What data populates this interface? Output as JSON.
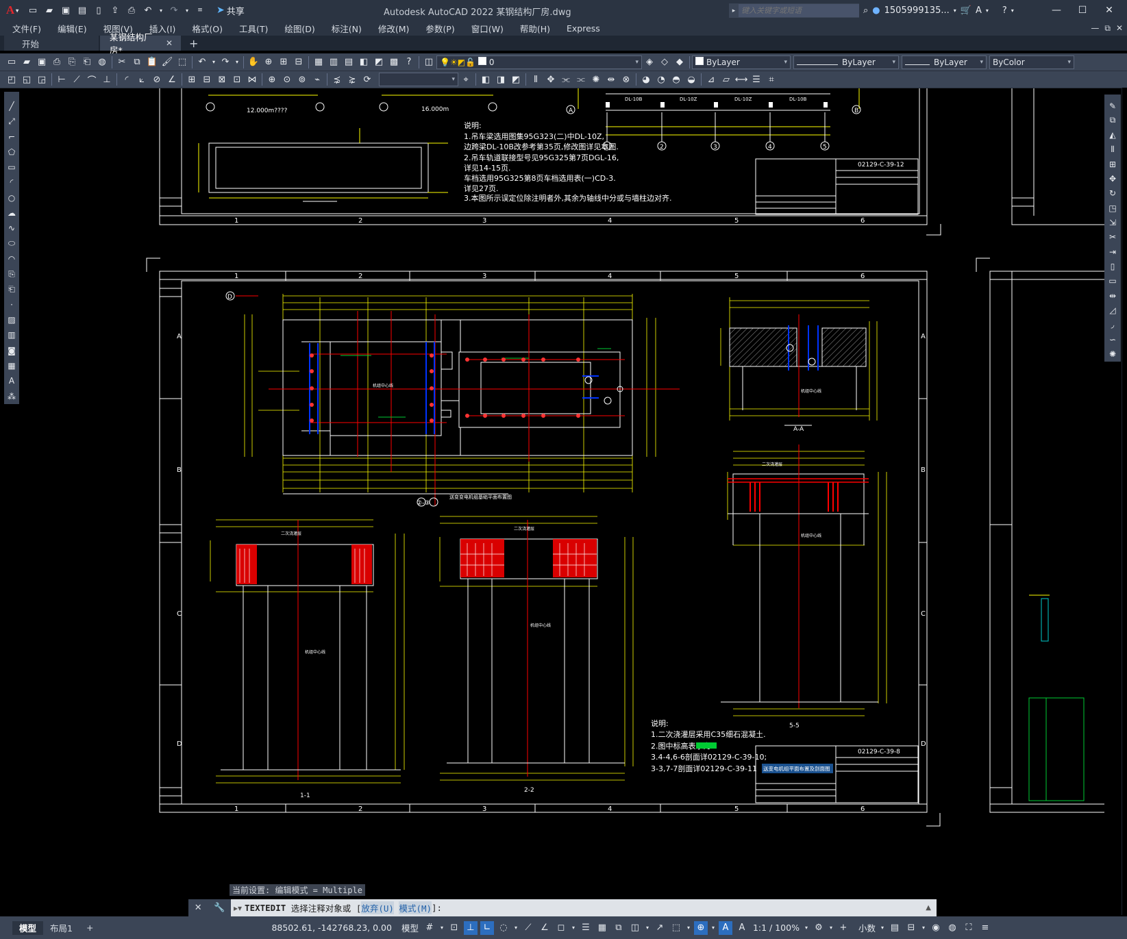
{
  "app": {
    "title": "Autodesk AutoCAD 2022    某钢结构厂房.dwg",
    "logo_letter": "A",
    "share_label": "共享",
    "search_placeholder": "键入关键字或短语",
    "user": "1505999135...",
    "colors": {
      "title_bg": "#2b3442",
      "toolbar_bg": "#3b4556",
      "canvas_bg": "#000000",
      "accent": "#2c6ebf",
      "logo": "#e2262b"
    }
  },
  "menu": {
    "items": [
      "文件(F)",
      "编辑(E)",
      "视图(V)",
      "插入(I)",
      "格式(O)",
      "工具(T)",
      "绘图(D)",
      "标注(N)",
      "修改(M)",
      "参数(P)",
      "窗口(W)",
      "帮助(H)",
      "Express"
    ]
  },
  "tabs": {
    "start": "开始",
    "active": "某钢结构厂房*",
    "plus": "+"
  },
  "toolbar": {
    "layer_value": "0",
    "color_value": "ByLayer",
    "linetype_value": "ByLayer",
    "lineweight_value": "ByLayer",
    "plotstyle_value": "ByColor"
  },
  "drawing": {
    "grid_cols": [
      "1",
      "2",
      "3",
      "4",
      "5",
      "6"
    ],
    "grid_rows": [
      "A",
      "B",
      "C",
      "D"
    ],
    "top_sheet": {
      "elev1": "12.000m????",
      "elev2": "16.000m",
      "notes": [
        "说明:",
        "1.吊车梁选用图集95G323(二)中DL-10Z,",
        "边跨梁DL-10B改参考第35页,修改图详见本图.",
        "2.吊车轨道联接型号见95G325第7页DGL-16,",
        "详见14-15页.",
        "车档选用95G325第8页车档选用表(一)CD-3.",
        "详见27页.",
        "3.本图所示误定位除注明者外,其余为轴线中分或与墙柱边对齐."
      ],
      "title_no": "02129-C-39-12",
      "beam_labels": [
        "DL-10B",
        "DL-10Z",
        "DL-10Z",
        "DL-10B"
      ],
      "axis_marks": [
        "5",
        "6",
        "5",
        "6",
        "A",
        "B",
        "1",
        "2",
        "3",
        "4",
        "5"
      ]
    },
    "main_sheet": {
      "notes": [
        "说明:",
        "1.二次浇灌层采用C35细石混凝土.",
        "2.图中标高表示为",
        "3.4-4,6-6剖面详02129-C-39-10;",
        "3-3,7-7剖面详02129-C-39-11"
      ],
      "title_no": "02129-C-39-8",
      "title_name": "送变电机组平面布置及剖面图",
      "plan_caption": "送变变电机组基础平面布置图",
      "plan_axis": "②-③",
      "sections": [
        "A-A",
        "1-1",
        "2-2",
        "5-5"
      ],
      "centerline": "机组中心线",
      "grout": "二次浇灌层",
      "top_axis_mark": "D"
    }
  },
  "command": {
    "history": "当前设置: 编辑模式 = Multiple",
    "name": "TEXTEDIT",
    "prompt": " 选择注释对象或 [",
    "opt1": "放弃(U)",
    "mid": " ",
    "opt2": "模式(M)",
    "end": "]:"
  },
  "status": {
    "tab_model": "模型",
    "tab_layout": "布局1",
    "coords": "88502.61, -142768.23, 0.00",
    "space": "模型",
    "scale": "1:1 / 100%",
    "units": "小数"
  }
}
